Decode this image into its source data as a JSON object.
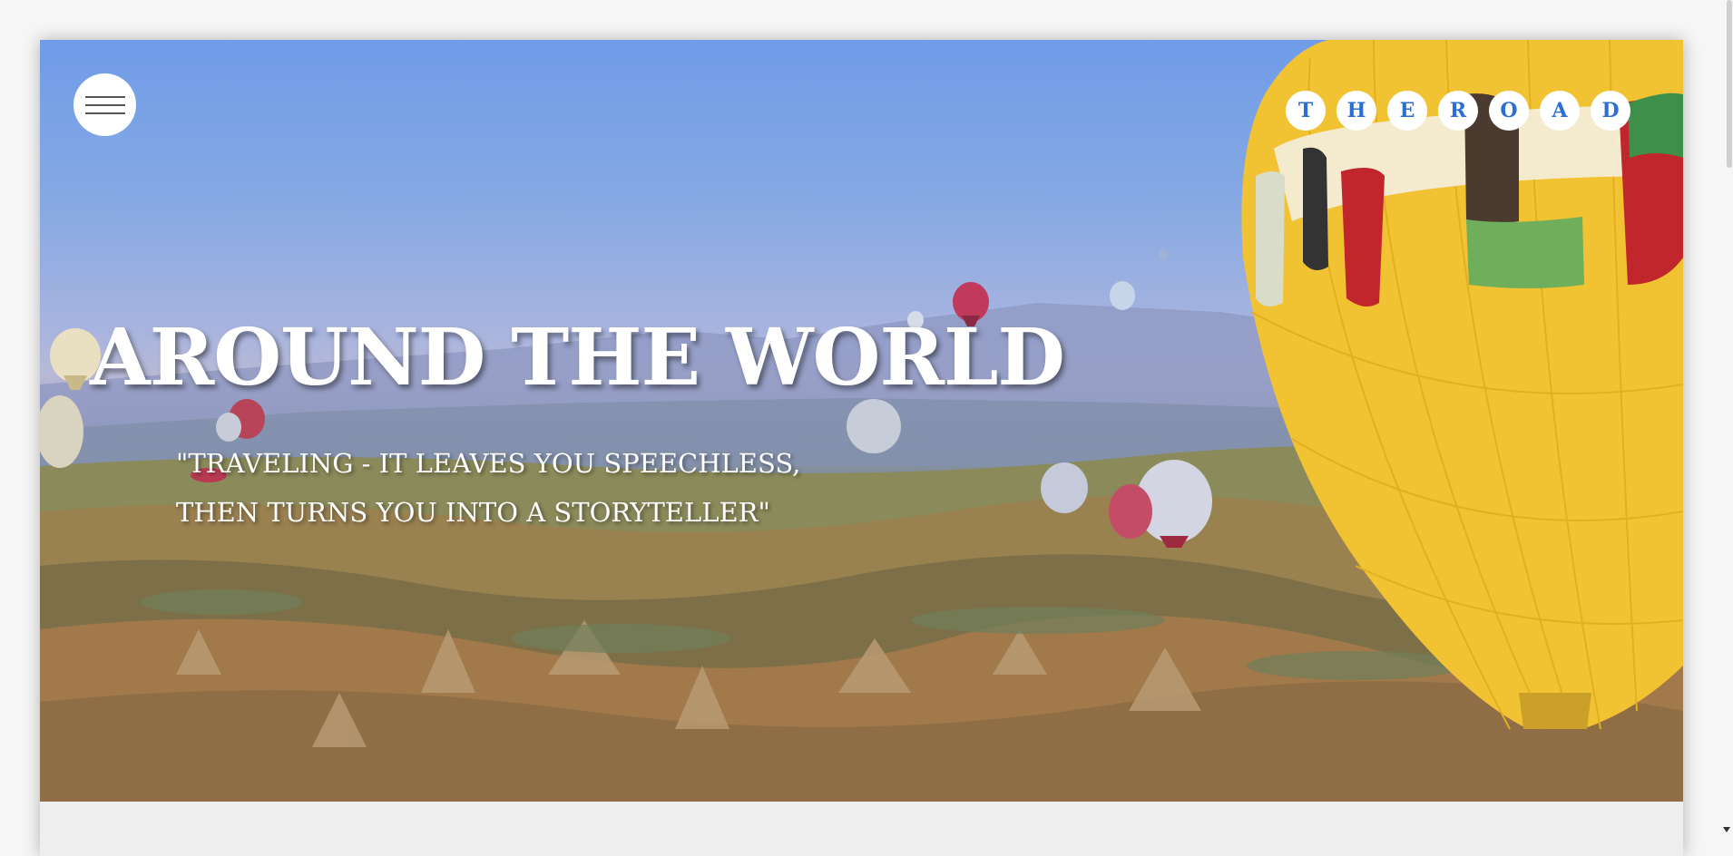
{
  "header": {
    "menu_icon": "hamburger-icon",
    "brand_letters": [
      "T",
      "H",
      "E",
      "R",
      "O",
      "A",
      "D"
    ]
  },
  "hero": {
    "title": "AROUND THE WORLD",
    "quote_line_1": "\"TRAVELING - IT LEAVES YOU SPEECHLESS,",
    "quote_line_2": "THEN TURNS YOU INTO A STORYTELLER\"",
    "background": "hot-air-balloons-landscape-photo"
  },
  "colors": {
    "brand_letter": "#2c6fd4",
    "sky_top": "#6f9ce8",
    "balloon_yellow": "#f1c232"
  }
}
